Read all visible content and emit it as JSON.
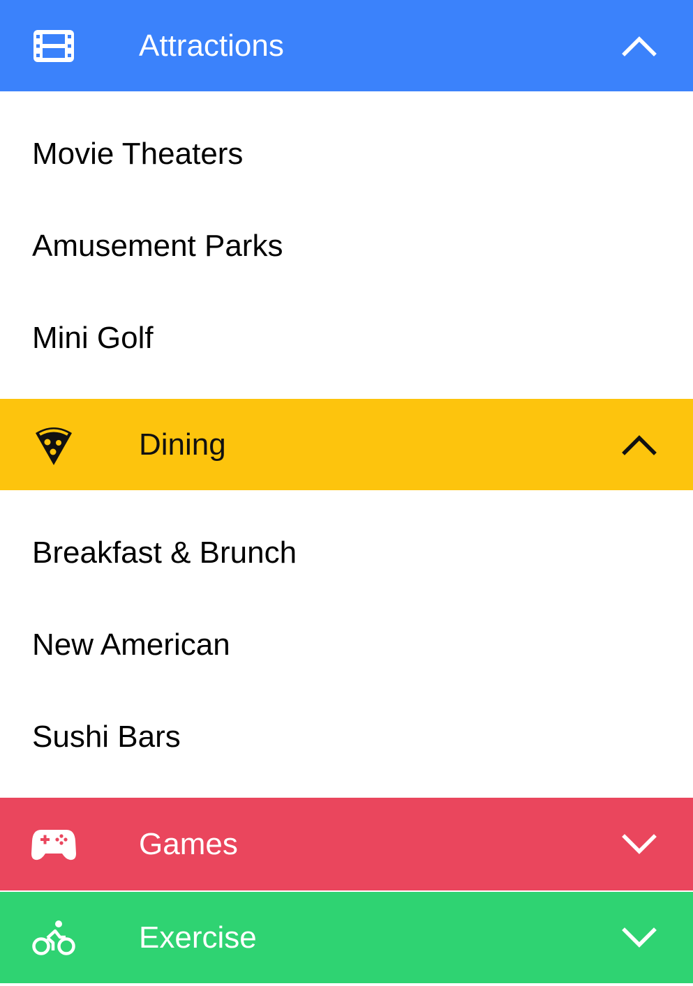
{
  "colors": {
    "attractions": "#3b82fb",
    "dining": "#fdc40d",
    "games": "#ea465d",
    "exercise": "#2fd372",
    "light_text": "#ffffff",
    "dark_text": "#111111"
  },
  "sections": [
    {
      "id": "attractions",
      "title": "Attractions",
      "icon": "movie-film-icon",
      "chevron": "chevron-up-icon",
      "expanded": true,
      "items": [
        "Movie Theaters",
        "Amusement Parks",
        "Mini Golf"
      ]
    },
    {
      "id": "dining",
      "title": "Dining",
      "icon": "pizza-icon",
      "chevron": "chevron-up-icon",
      "expanded": true,
      "items": [
        "Breakfast & Brunch",
        "New American",
        "Sushi Bars"
      ]
    },
    {
      "id": "games",
      "title": "Games",
      "icon": "gamepad-icon",
      "chevron": "chevron-down-icon",
      "expanded": false,
      "items": []
    },
    {
      "id": "exercise",
      "title": "Exercise",
      "icon": "bike-icon",
      "chevron": "chevron-down-icon",
      "expanded": false,
      "items": []
    }
  ]
}
